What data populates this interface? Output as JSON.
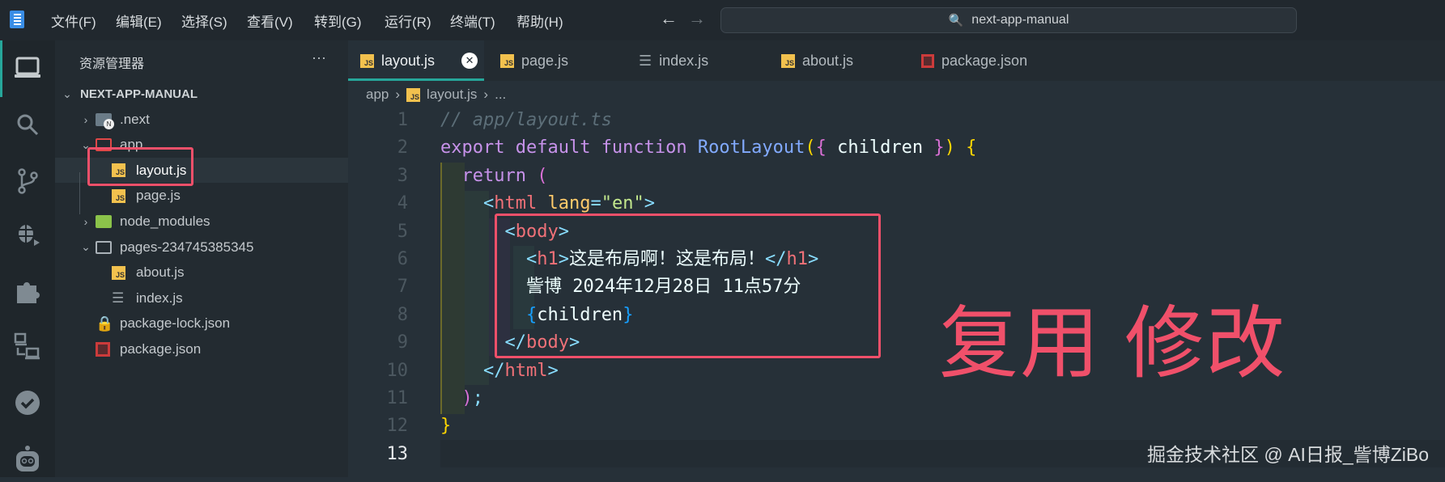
{
  "titlebar": {
    "menus": [
      "文件(F)",
      "编辑(E)",
      "选择(S)",
      "查看(V)",
      "转到(G)",
      "运行(R)",
      "终端(T)",
      "帮助(H)"
    ],
    "search_text": "next-app-manual"
  },
  "sidebar": {
    "title": "资源管理器",
    "more": "···",
    "root": "NEXT-APP-MANUAL",
    "items": [
      {
        "label": ".next",
        "icon": "nextjs-folder-icon"
      },
      {
        "label": "app",
        "icon": "app-folder-icon"
      },
      {
        "label": "layout.js",
        "icon": "js-file-icon"
      },
      {
        "label": "page.js",
        "icon": "js-file-icon"
      },
      {
        "label": "node_modules",
        "icon": "node-folder-icon"
      },
      {
        "label": "pages-234745385345",
        "icon": "folder-icon"
      },
      {
        "label": "about.js",
        "icon": "js-file-icon"
      },
      {
        "label": "index.js",
        "icon": "list-file-icon"
      },
      {
        "label": "package-lock.json",
        "icon": "lock-icon"
      },
      {
        "label": "package.json",
        "icon": "npm-icon"
      }
    ]
  },
  "tabs": [
    {
      "label": "layout.js",
      "active": true
    },
    {
      "label": "page.js"
    },
    {
      "label": "index.js"
    },
    {
      "label": "about.js"
    },
    {
      "label": "package.json"
    }
  ],
  "breadcrumb": {
    "folder": "app",
    "file": "layout.js",
    "more": "..."
  },
  "code": {
    "line_numbers": [
      "1",
      "2",
      "3",
      "4",
      "5",
      "6",
      "7",
      "8",
      "9",
      "10",
      "11",
      "12",
      "13"
    ],
    "lines": [
      [
        {
          "t": "// app/layout.ts",
          "c": "#5c6e78",
          "i": 1
        }
      ],
      [
        {
          "t": "export ",
          "c": "#c792ea"
        },
        {
          "t": "default ",
          "c": "#c792ea"
        },
        {
          "t": "function ",
          "c": "#c792ea"
        },
        {
          "t": "RootLayout",
          "c": "#82aaff"
        },
        {
          "t": "(",
          "c": "#ffd700"
        },
        {
          "t": "{ ",
          "c": "#da70d6"
        },
        {
          "t": "children ",
          "c": "#eeffff"
        },
        {
          "t": "}",
          "c": "#da70d6"
        },
        {
          "t": ") ",
          "c": "#ffd700"
        },
        {
          "t": "{",
          "c": "#ffd700"
        }
      ],
      [
        {
          "t": "  return ",
          "c": "#c792ea"
        },
        {
          "t": "(",
          "c": "#da70d6"
        }
      ],
      [
        {
          "t": "    <",
          "c": "#89ddff"
        },
        {
          "t": "html ",
          "c": "#f07178"
        },
        {
          "t": "lang",
          "c": "#ffcb6b"
        },
        {
          "t": "=",
          "c": "#89ddff"
        },
        {
          "t": "\"en\"",
          "c": "#c3e88d"
        },
        {
          "t": ">",
          "c": "#89ddff"
        }
      ],
      [
        {
          "t": "      <",
          "c": "#89ddff"
        },
        {
          "t": "body",
          "c": "#f07178"
        },
        {
          "t": ">",
          "c": "#89ddff"
        }
      ],
      [
        {
          "t": "        <",
          "c": "#89ddff"
        },
        {
          "t": "h1",
          "c": "#f07178"
        },
        {
          "t": ">",
          "c": "#89ddff"
        },
        {
          "t": "这是布局啊！这是布局！",
          "c": "#eeffff"
        },
        {
          "t": "</",
          "c": "#89ddff"
        },
        {
          "t": "h1",
          "c": "#f07178"
        },
        {
          "t": ">",
          "c": "#89ddff"
        }
      ],
      [
        {
          "t": "        訾博 2024年12月28日 11点57分",
          "c": "#eeffff"
        }
      ],
      [
        {
          "t": "        {",
          "c": "#179fff"
        },
        {
          "t": "children",
          "c": "#eeffff"
        },
        {
          "t": "}",
          "c": "#179fff"
        }
      ],
      [
        {
          "t": "      </",
          "c": "#89ddff"
        },
        {
          "t": "body",
          "c": "#f07178"
        },
        {
          "t": ">",
          "c": "#89ddff"
        }
      ],
      [
        {
          "t": "    </",
          "c": "#89ddff"
        },
        {
          "t": "html",
          "c": "#f07178"
        },
        {
          "t": ">",
          "c": "#89ddff"
        }
      ],
      [
        {
          "t": "  )",
          "c": "#da70d6"
        },
        {
          "t": ";",
          "c": "#89ddff"
        }
      ],
      [
        {
          "t": "}",
          "c": "#ffd700"
        }
      ],
      [
        {
          "t": "",
          "c": "#eeffff"
        }
      ]
    ]
  },
  "annotation": "复用 修改",
  "watermark": "掘金技术社区 @ AI日报_訾博ZiBo",
  "colors": {
    "accent": "#26a69a",
    "highlight": "#f0506a"
  }
}
